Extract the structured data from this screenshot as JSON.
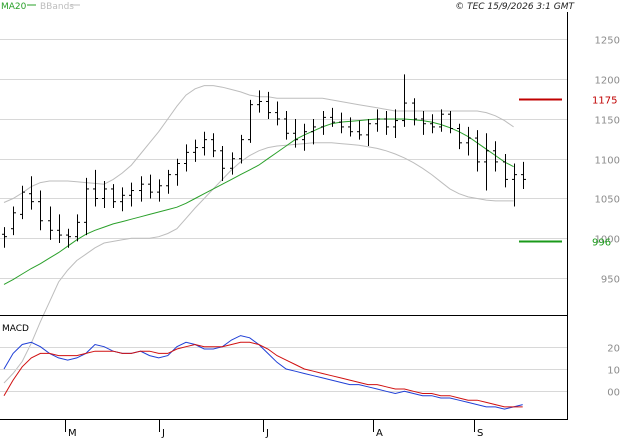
{
  "header": {
    "ma_label": "MA20",
    "bbands_label": "BBands",
    "copyright": "© TEC 15/9/2026 3:1 GMT"
  },
  "colors": {
    "ma": "#2aa02a",
    "bbands": "#bdbdbd",
    "price": "#000000",
    "resistance": "#c00000",
    "support": "#1a9a1a",
    "macd": "#1f3fd6",
    "signal": "#d01010",
    "grid": "#d8d8d8",
    "axis_text": "#8c8c8c"
  },
  "chart_data": [
    {
      "type": "ohlc",
      "y_ticks": [
        "1250",
        "1200",
        "1150",
        "1100",
        "1050",
        "1000",
        "950"
      ],
      "ylim": [
        906,
        1282
      ],
      "x_labels": [
        "M",
        "J",
        "J",
        "A",
        "S"
      ],
      "levels": [
        {
          "label": "1175",
          "value": 1175,
          "color": "resistance"
        },
        {
          "label": "996",
          "value": 996,
          "color": "support"
        }
      ],
      "series": [
        {
          "name": "MA20",
          "values": [
            942,
            948,
            955,
            962,
            968,
            975,
            982,
            990,
            998,
            1005,
            1010,
            1014,
            1018,
            1021,
            1024,
            1027,
            1030,
            1033,
            1036,
            1039,
            1044,
            1050,
            1056,
            1062,
            1068,
            1074,
            1080,
            1086,
            1092,
            1100,
            1108,
            1116,
            1124,
            1130,
            1135,
            1140,
            1144,
            1146,
            1147,
            1148,
            1149,
            1150,
            1150,
            1150,
            1150,
            1149,
            1148,
            1146,
            1143,
            1139,
            1134,
            1128,
            1120,
            1112,
            1104,
            1096,
            1090
          ]
        },
        {
          "name": "BBands upper",
          "values": [
            1045,
            1050,
            1057,
            1065,
            1070,
            1072,
            1072,
            1072,
            1071,
            1070,
            1069,
            1068,
            1074,
            1082,
            1092,
            1106,
            1120,
            1134,
            1150,
            1166,
            1180,
            1188,
            1192,
            1192,
            1190,
            1187,
            1184,
            1180,
            1178,
            1178,
            1176,
            1176,
            1176,
            1176,
            1176,
            1176,
            1174,
            1172,
            1170,
            1168,
            1166,
            1164,
            1162,
            1160,
            1160,
            1160,
            1160,
            1160,
            1160,
            1160,
            1160,
            1160,
            1160,
            1158,
            1154,
            1148,
            1140
          ]
        },
        {
          "name": "BBands lower",
          "values": [
            818,
            830,
            845,
            868,
            895,
            920,
            945,
            960,
            972,
            980,
            988,
            994,
            996,
            998,
            1000,
            1000,
            1000,
            1002,
            1006,
            1012,
            1025,
            1038,
            1050,
            1062,
            1074,
            1086,
            1096,
            1104,
            1110,
            1114,
            1116,
            1117,
            1118,
            1119,
            1120,
            1120,
            1120,
            1119,
            1118,
            1117,
            1115,
            1113,
            1110,
            1106,
            1101,
            1095,
            1088,
            1080,
            1071,
            1062,
            1056,
            1052,
            1050,
            1048,
            1047,
            1047,
            1047
          ]
        },
        {
          "name": "Price",
          "ohlc": [
            [
              1005,
              1014,
              988,
              1002
            ],
            [
              1012,
              1040,
              1004,
              1032
            ],
            [
              1030,
              1066,
              1024,
              1058
            ],
            [
              1056,
              1078,
              1036,
              1046
            ],
            [
              1046,
              1060,
              1010,
              1022
            ],
            [
              1022,
              1040,
              998,
              1010
            ],
            [
              1010,
              1030,
              994,
              1004
            ],
            [
              1004,
              1012,
              988,
              1002
            ],
            [
              1002,
              1030,
              996,
              1020
            ],
            [
              1020,
              1076,
              1004,
              1062
            ],
            [
              1062,
              1086,
              1040,
              1050
            ],
            [
              1050,
              1072,
              1038,
              1062
            ],
            [
              1062,
              1068,
              1038,
              1046
            ],
            [
              1046,
              1064,
              1034,
              1054
            ],
            [
              1054,
              1070,
              1040,
              1060
            ],
            [
              1060,
              1078,
              1046,
              1068
            ],
            [
              1068,
              1080,
              1050,
              1058
            ],
            [
              1058,
              1074,
              1046,
              1066
            ],
            [
              1066,
              1086,
              1056,
              1080
            ],
            [
              1080,
              1100,
              1066,
              1094
            ],
            [
              1094,
              1118,
              1084,
              1108
            ],
            [
              1108,
              1124,
              1096,
              1114
            ],
            [
              1114,
              1134,
              1104,
              1124
            ],
            [
              1124,
              1132,
              1102,
              1110
            ],
            [
              1110,
              1116,
              1072,
              1088
            ],
            [
              1088,
              1108,
              1080,
              1100
            ],
            [
              1100,
              1130,
              1094,
              1124
            ],
            [
              1124,
              1174,
              1120,
              1168
            ],
            [
              1168,
              1186,
              1158,
              1172
            ],
            [
              1172,
              1184,
              1150,
              1158
            ],
            [
              1158,
              1172,
              1142,
              1150
            ],
            [
              1150,
              1160,
              1124,
              1132
            ],
            [
              1132,
              1150,
              1114,
              1124
            ],
            [
              1124,
              1144,
              1110,
              1134
            ],
            [
              1134,
              1150,
              1118,
              1140
            ],
            [
              1140,
              1160,
              1130,
              1152
            ],
            [
              1152,
              1164,
              1140,
              1146
            ],
            [
              1146,
              1158,
              1132,
              1140
            ],
            [
              1140,
              1152,
              1128,
              1134
            ],
            [
              1134,
              1148,
              1124,
              1130
            ],
            [
              1130,
              1150,
              1116,
              1144
            ],
            [
              1144,
              1162,
              1134,
              1150
            ],
            [
              1150,
              1160,
              1130,
              1140
            ],
            [
              1140,
              1162,
              1126,
              1148
            ],
            [
              1148,
              1206,
              1140,
              1170
            ],
            [
              1170,
              1176,
              1142,
              1150
            ],
            [
              1150,
              1160,
              1130,
              1144
            ],
            [
              1144,
              1156,
              1132,
              1140
            ],
            [
              1140,
              1162,
              1134,
              1156
            ],
            [
              1156,
              1160,
              1132,
              1138
            ],
            [
              1138,
              1144,
              1112,
              1120
            ],
            [
              1120,
              1140,
              1104,
              1126
            ],
            [
              1126,
              1136,
              1084,
              1096
            ],
            [
              1096,
              1132,
              1060,
              1110
            ],
            [
              1110,
              1122,
              1084,
              1096
            ],
            [
              1096,
              1106,
              1064,
              1074
            ],
            [
              1074,
              1094,
              1040,
              1080
            ],
            [
              1080,
              1096,
              1062,
              1074
            ]
          ]
        }
      ]
    },
    {
      "type": "line",
      "title": "MACD",
      "y_ticks": [
        "20",
        "10",
        "00"
      ],
      "ylim": [
        -12,
        32
      ],
      "series": [
        {
          "name": "MACD",
          "values": [
            10,
            17,
            21,
            22,
            20,
            17,
            15,
            14,
            15,
            17,
            21,
            20,
            18,
            17,
            17,
            18,
            16,
            15,
            16,
            20,
            22,
            21,
            19,
            19,
            20,
            23,
            25,
            24,
            21,
            17,
            13,
            10,
            9,
            8,
            7,
            6,
            5,
            4,
            3,
            3,
            2,
            1,
            0,
            -1,
            0,
            -1,
            -2,
            -2,
            -3,
            -3,
            -4,
            -5,
            -6,
            -7,
            -7,
            -8,
            -7,
            -6
          ]
        },
        {
          "name": "Signal",
          "values": [
            -2,
            5,
            11,
            15,
            17,
            17,
            16,
            16,
            16,
            17,
            18,
            18,
            18,
            17,
            17,
            18,
            18,
            17,
            17,
            19,
            20,
            21,
            20,
            20,
            20,
            21,
            22,
            22,
            21,
            19,
            16,
            14,
            12,
            10,
            9,
            8,
            7,
            6,
            5,
            4,
            3,
            3,
            2,
            1,
            1,
            0,
            -1,
            -1,
            -2,
            -2,
            -3,
            -4,
            -4,
            -5,
            -6,
            -7,
            -7,
            -7
          ]
        }
      ]
    }
  ]
}
